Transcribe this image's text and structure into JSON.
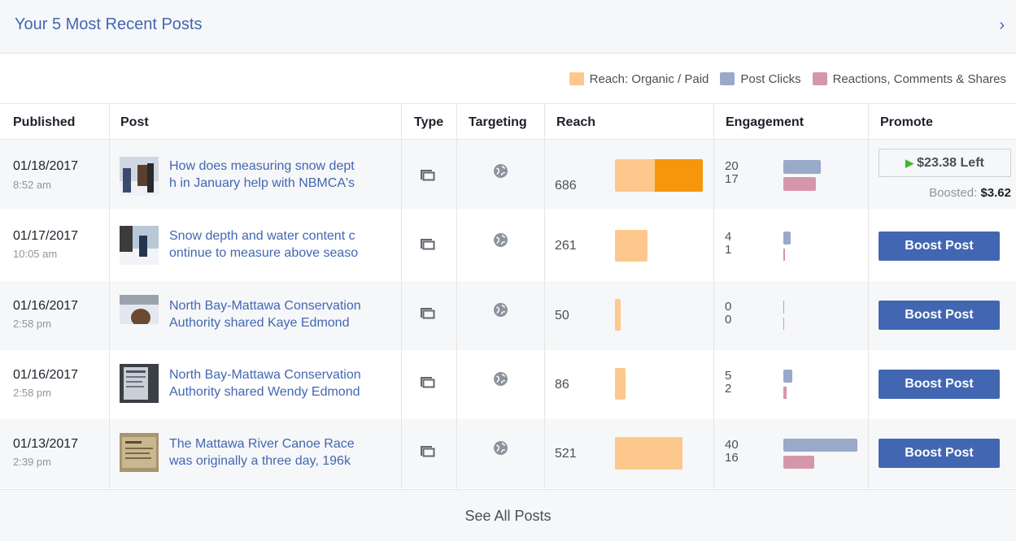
{
  "header": {
    "title": "Your 5 Most Recent Posts",
    "chevron": "›"
  },
  "legend": [
    {
      "label": "Reach: Organic / Paid",
      "color": "#fdc88b"
    },
    {
      "label": "Post Clicks",
      "color": "#98a9c9"
    },
    {
      "label": "Reactions, Comments & Shares",
      "color": "#d596a9"
    }
  ],
  "columns": {
    "published": "Published",
    "post": "Post",
    "type": "Type",
    "targeting": "Targeting",
    "reach": "Reach",
    "engagement": "Engagement",
    "promote": "Promote"
  },
  "colors": {
    "organic": "#fdc88b",
    "paid": "#f5960d",
    "clicks": "#98a9c9",
    "reactions": "#d596a9",
    "accent": "#4267b2"
  },
  "rows": [
    {
      "date": "01/18/2017",
      "time": "8:52 am",
      "text1": "How does measuring snow dept",
      "text2": "h in January help with NBMCA's",
      "reach": "686",
      "reach_organic_frac": 0.42,
      "clicks": "20",
      "reactions": "17"
    },
    {
      "date": "01/17/2017",
      "time": "10:05 am",
      "text1": "Snow depth and water content c",
      "text2": "ontinue to measure above seaso",
      "reach": "261",
      "clicks": "4",
      "reactions": "1"
    },
    {
      "date": "01/16/2017",
      "time": "2:58 pm",
      "text1": "North Bay-Mattawa Conservation",
      "text2": "Authority shared Kaye Edmond",
      "reach": "50",
      "clicks": "0",
      "reactions": "0"
    },
    {
      "date": "01/16/2017",
      "time": "2:58 pm",
      "text1": "North Bay-Mattawa Conservation",
      "text2": "Authority shared Wendy Edmond",
      "reach": "86",
      "clicks": "5",
      "reactions": "2"
    },
    {
      "date": "01/13/2017",
      "time": "2:39 pm",
      "text1": "The Mattawa River Canoe Race",
      "text2": "was originally a three day, 196k",
      "reach": "521",
      "clicks": "40",
      "reactions": "16"
    }
  ],
  "promote": {
    "left_label": "$23.38 Left",
    "boosted_label": "Boosted:",
    "boosted_value": "$3.62",
    "boost_label": "Boost Post"
  },
  "footer": {
    "label": "See All Posts"
  }
}
